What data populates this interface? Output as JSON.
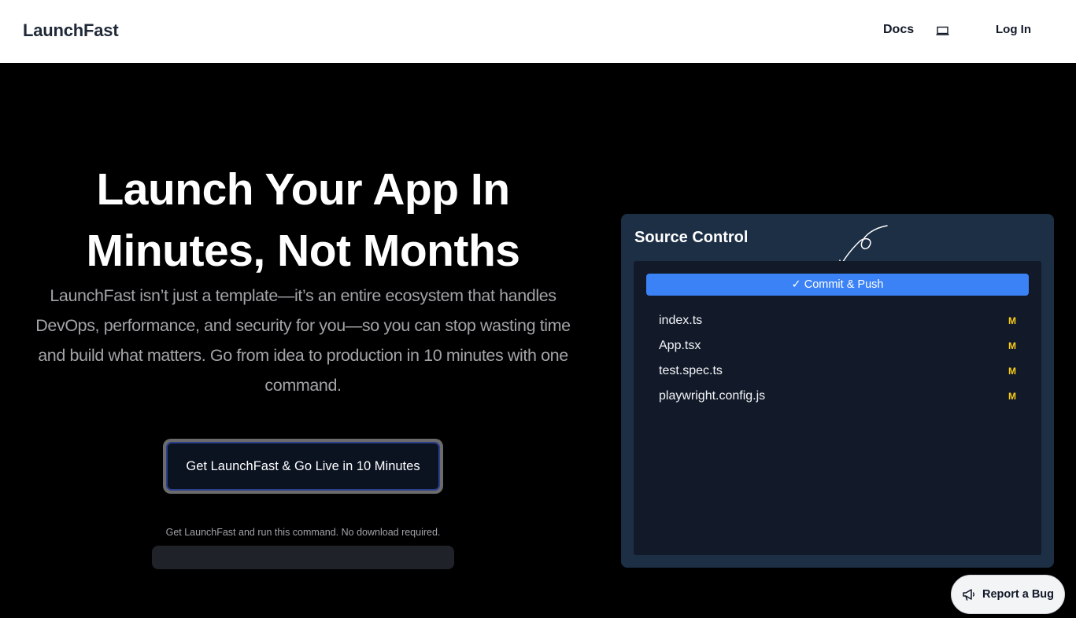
{
  "nav": {
    "brand": "LaunchFast",
    "docs_label": "Docs",
    "device_icon": "laptop-icon",
    "login_label": "Log In"
  },
  "hero": {
    "headline_line1": "Launch Your App In",
    "headline_line2": "Minutes, Not Months",
    "subtext": "LaunchFast isn’t just a template—it’s an entire ecosystem that handles DevOps, performance, and security for you—so you can stop wasting time and build what matters. Go from idea to production in 10 minutes with one command.",
    "cta_label": "Get LaunchFast & Go Live in 10 Minutes",
    "cta_note": "Get LaunchFast and run this command. No download required."
  },
  "source_control": {
    "title": "Source Control",
    "commit_label": "✓ Commit & Push",
    "files": [
      {
        "name": "index.ts",
        "status": "M"
      },
      {
        "name": "App.tsx",
        "status": "M"
      },
      {
        "name": "test.spec.ts",
        "status": "M"
      },
      {
        "name": "playwright.config.js",
        "status": "M"
      }
    ]
  },
  "report_bug": {
    "label": "Report a Bug",
    "icon": "megaphone-icon"
  },
  "colors": {
    "accent": "#3b82f6",
    "status_modified": "#facc15",
    "panel_bg": "#1d2f45"
  }
}
